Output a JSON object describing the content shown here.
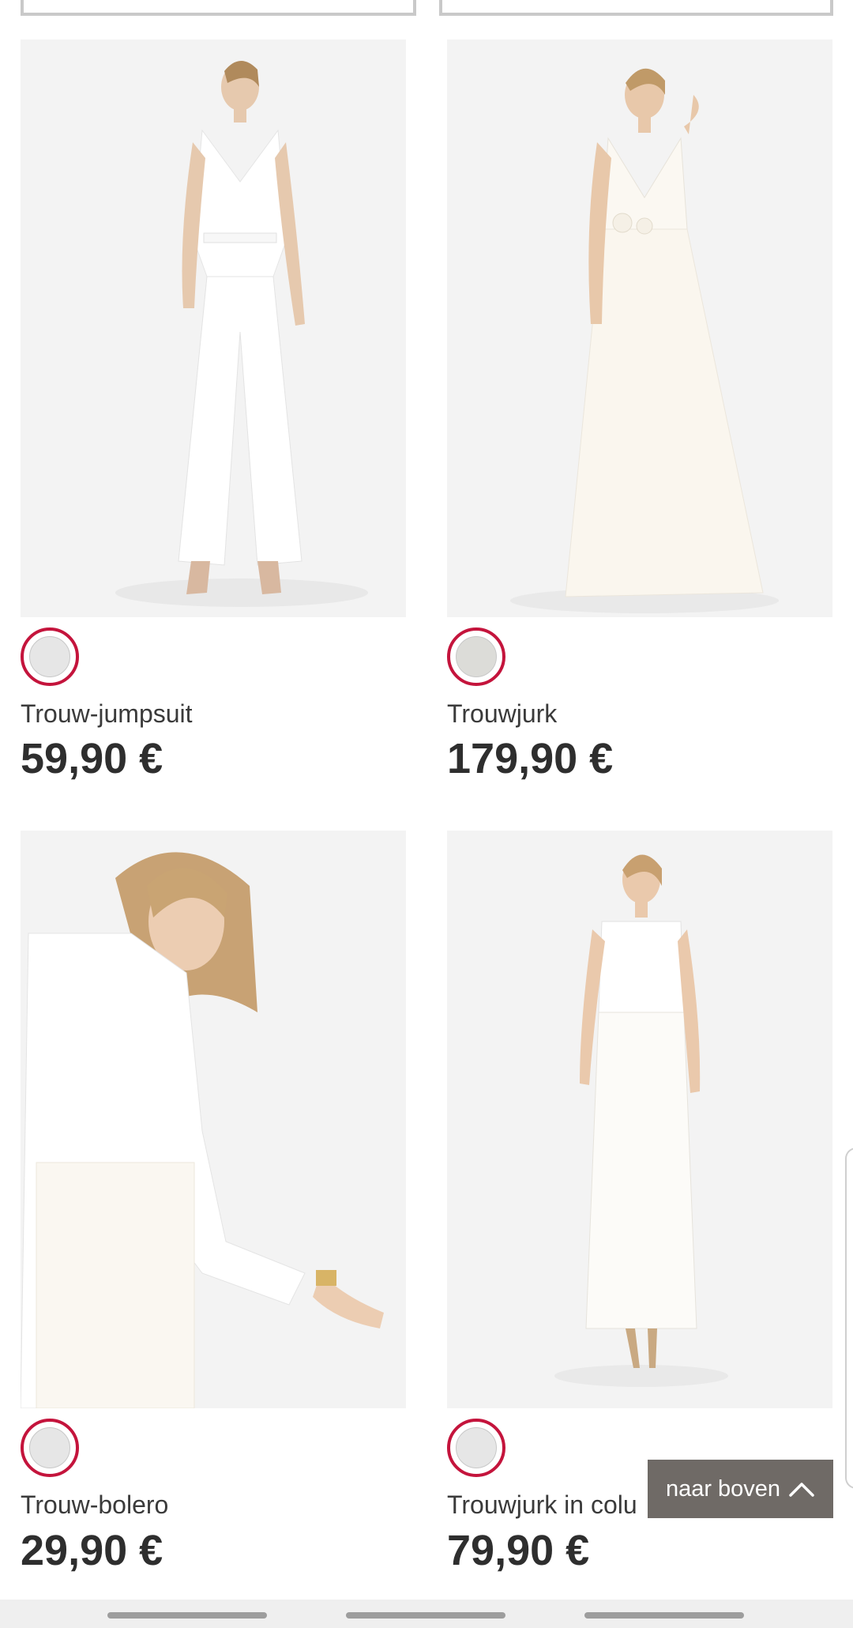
{
  "products": [
    {
      "name": "Trouw-jumpsuit",
      "price": "59,90 €",
      "image": "white wide-leg wedding jumpsuit",
      "swatch_color": "#e6e6e6"
    },
    {
      "name": "Trouwjurk",
      "price": "179,90 €",
      "image": "ivory tulle wedding gown",
      "swatch_color": "#dcdcd8"
    },
    {
      "name": "Trouw-bolero",
      "price": "29,90 €",
      "image": "white bolero over lace dress",
      "swatch_color": "#e6e6e6"
    },
    {
      "name": "Trouwjurk in colu",
      "price": "79,90 €",
      "image": "white lace column wedding dress",
      "swatch_color": "#e6e6e6"
    }
  ],
  "back_to_top": {
    "label": "naar boven",
    "icon": "chevron-up-icon"
  },
  "colors": {
    "accent": "#c4143c",
    "button_bg": "#6f6a66",
    "text": "#333333"
  }
}
